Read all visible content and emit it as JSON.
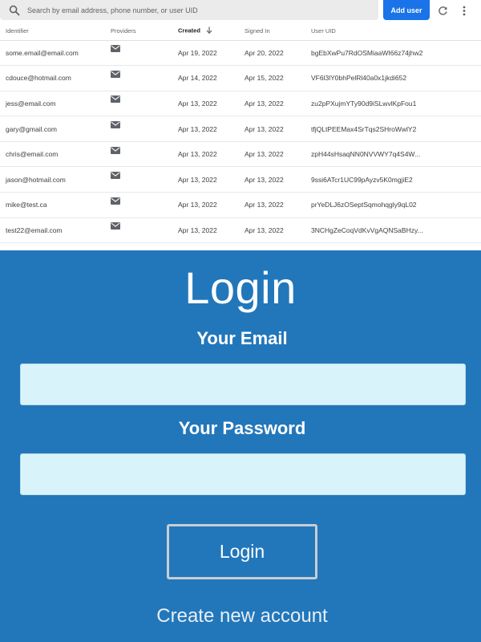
{
  "colors": {
    "accent": "#1a73e8",
    "login_background": "#2277bb",
    "field_background": "#d8f4fa"
  },
  "toolbar": {
    "search_placeholder": "Search by email address, phone number, or user UID",
    "search_icon": "search-icon",
    "add_user_label": "Add user",
    "refresh_icon": "refresh-icon",
    "more_icon": "more-vertical-icon"
  },
  "table": {
    "headers": {
      "identifier": "Identifier",
      "providers": "Providers",
      "created": "Created",
      "signed_in": "Signed In",
      "user_uid": "User UID"
    },
    "sort": {
      "column": "created",
      "direction": "descending",
      "icon": "arrow-down-icon"
    },
    "rows": [
      {
        "identifier": "some.email@email.com",
        "provider": "mail-icon",
        "created": "Apr 19, 2022",
        "signed_in": "Apr 20, 2022",
        "uid": "bgEbXwPu7RdOSMiaaWI66z74jhw2"
      },
      {
        "identifier": "cdouce@hotmail.com",
        "provider": "mail-icon",
        "created": "Apr 14, 2022",
        "signed_in": "Apr 15, 2022",
        "uid": "VF6l3lY0bhPelRl40a0x1jkdi652"
      },
      {
        "identifier": "jess@email.com",
        "provider": "mail-icon",
        "created": "Apr 13, 2022",
        "signed_in": "Apr 13, 2022",
        "uid": "zu2pPXujmYTy90d9iSLwvlKpFou1"
      },
      {
        "identifier": "gary@gmail.com",
        "provider": "mail-icon",
        "created": "Apr 13, 2022",
        "signed_in": "Apr 13, 2022",
        "uid": "tfjQLtPEEMax4SrTqs2SHroWwlY2"
      },
      {
        "identifier": "chris@email.com",
        "provider": "mail-icon",
        "created": "Apr 13, 2022",
        "signed_in": "Apr 13, 2022",
        "uid": "zpH44sHsaqNN0NVVWY7q4S4W..."
      },
      {
        "identifier": "jason@hotmail.com",
        "provider": "mail-icon",
        "created": "Apr 13, 2022",
        "signed_in": "Apr 13, 2022",
        "uid": "9ssi6ATcr1UC99pAyzv5K0mgjiE2"
      },
      {
        "identifier": "mike@test.ca",
        "provider": "mail-icon",
        "created": "Apr 13, 2022",
        "signed_in": "Apr 13, 2022",
        "uid": "prYeDLJ6zOSeptSqmohqgly9qL02"
      },
      {
        "identifier": "test22@email.com",
        "provider": "mail-icon",
        "created": "Apr 13, 2022",
        "signed_in": "Apr 13, 2022",
        "uid": "3NCHgZeCoqVdKvVgAQNSaBHzy..."
      }
    ]
  },
  "login": {
    "title": "Login",
    "email_label": "Your Email",
    "email_value": "",
    "password_label": "Your Password",
    "password_value": "",
    "button_label": "Login",
    "create_account_link": "Create new account"
  }
}
